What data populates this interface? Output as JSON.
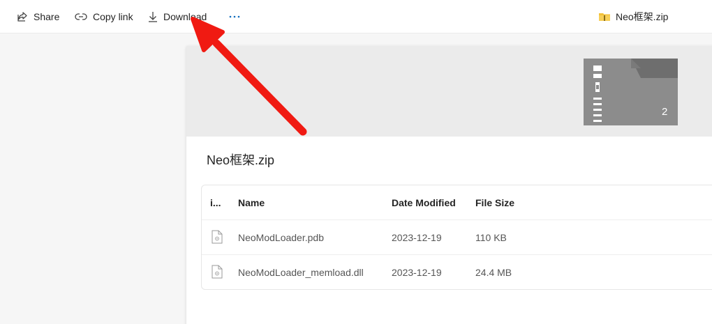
{
  "toolbar": {
    "share_label": "Share",
    "copy_link_label": "Copy link",
    "download_label": "Download",
    "more_label": "···",
    "filename": "Neo框架.zip"
  },
  "preview": {
    "item_count": "2",
    "title": "Neo框架.zip"
  },
  "table": {
    "headers": {
      "icon": "i...",
      "name": "Name",
      "date": "Date Modified",
      "size": "File Size"
    },
    "rows": [
      {
        "name": "NeoModLoader.pdb",
        "date": "2023-12-19",
        "size": "110 KB"
      },
      {
        "name": "NeoModLoader_memload.dll",
        "date": "2023-12-19",
        "size": "24.4 MB"
      }
    ]
  },
  "colors": {
    "annotation_arrow": "#f01a12",
    "folder_icon": "#f3c23a",
    "zip_thumb": "#8c8c8c",
    "accent": "#0f6cbd"
  },
  "icons": {
    "share": "share-icon",
    "copy_link": "link-icon",
    "download": "download-icon",
    "more": "more-icon",
    "zip_folder": "zip-folder-icon",
    "file": "file-icon"
  }
}
